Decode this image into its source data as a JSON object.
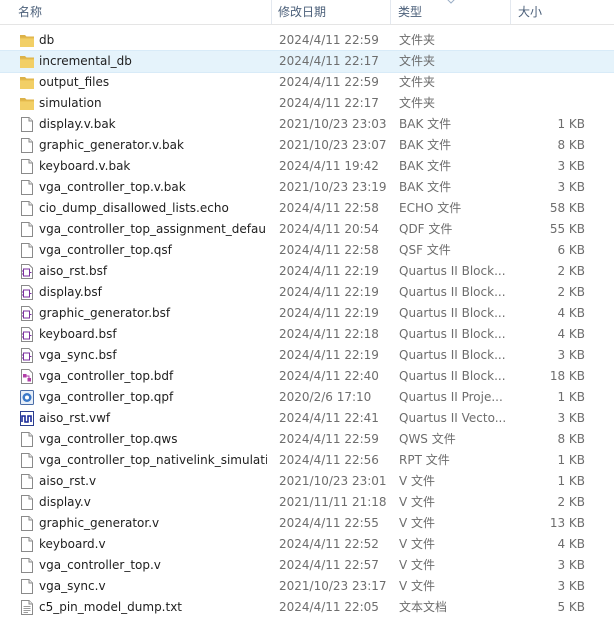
{
  "columns": {
    "name": "名称",
    "date": "修改日期",
    "type": "类型",
    "size": "大小"
  },
  "files": [
    {
      "name": "db",
      "date": "2024/4/11 22:59",
      "type": "文件夹",
      "size": "",
      "icon": "folder-icon"
    },
    {
      "name": "incremental_db",
      "date": "2024/4/11 22:17",
      "type": "文件夹",
      "size": "",
      "icon": "folder-icon",
      "selected": true
    },
    {
      "name": "output_files",
      "date": "2024/4/11 22:59",
      "type": "文件夹",
      "size": "",
      "icon": "folder-icon"
    },
    {
      "name": "simulation",
      "date": "2024/4/11 22:17",
      "type": "文件夹",
      "size": "",
      "icon": "folder-icon"
    },
    {
      "name": "display.v.bak",
      "date": "2021/10/23 23:03",
      "type": "BAK 文件",
      "size": "1 KB",
      "icon": "document-icon"
    },
    {
      "name": "graphic_generator.v.bak",
      "date": "2021/10/23 23:07",
      "type": "BAK 文件",
      "size": "8 KB",
      "icon": "document-icon"
    },
    {
      "name": "keyboard.v.bak",
      "date": "2024/4/11 19:42",
      "type": "BAK 文件",
      "size": "3 KB",
      "icon": "document-icon"
    },
    {
      "name": "vga_controller_top.v.bak",
      "date": "2021/10/23 23:19",
      "type": "BAK 文件",
      "size": "3 KB",
      "icon": "document-icon"
    },
    {
      "name": "cio_dump_disallowed_lists.echo",
      "date": "2024/4/11 22:58",
      "type": "ECHO 文件",
      "size": "58 KB",
      "icon": "document-icon"
    },
    {
      "name": "vga_controller_top_assignment_defau...",
      "date": "2024/4/11 20:54",
      "type": "QDF 文件",
      "size": "55 KB",
      "icon": "document-icon"
    },
    {
      "name": "vga_controller_top.qsf",
      "date": "2024/4/11 22:58",
      "type": "QSF 文件",
      "size": "6 KB",
      "icon": "document-icon"
    },
    {
      "name": "aiso_rst.bsf",
      "date": "2024/4/11 22:19",
      "type": "Quartus II Block...",
      "size": "2 KB",
      "icon": "bsf-file-icon"
    },
    {
      "name": "display.bsf",
      "date": "2024/4/11 22:19",
      "type": "Quartus II Block...",
      "size": "2 KB",
      "icon": "bsf-file-icon"
    },
    {
      "name": "graphic_generator.bsf",
      "date": "2024/4/11 22:19",
      "type": "Quartus II Block...",
      "size": "4 KB",
      "icon": "bsf-file-icon"
    },
    {
      "name": "keyboard.bsf",
      "date": "2024/4/11 22:18",
      "type": "Quartus II Block...",
      "size": "4 KB",
      "icon": "bsf-file-icon"
    },
    {
      "name": "vga_sync.bsf",
      "date": "2024/4/11 22:19",
      "type": "Quartus II Block...",
      "size": "3 KB",
      "icon": "bsf-file-icon"
    },
    {
      "name": "vga_controller_top.bdf",
      "date": "2024/4/11 22:40",
      "type": "Quartus II Block...",
      "size": "18 KB",
      "icon": "bdf-file-icon"
    },
    {
      "name": "vga_controller_top.qpf",
      "date": "2020/2/6 17:10",
      "type": "Quartus II Proje...",
      "size": "1 KB",
      "icon": "quartus-project-icon"
    },
    {
      "name": "aiso_rst.vwf",
      "date": "2024/4/11 22:41",
      "type": "Quartus II Vecto...",
      "size": "3 KB",
      "icon": "waveform-file-icon"
    },
    {
      "name": "vga_controller_top.qws",
      "date": "2024/4/11 22:59",
      "type": "QWS 文件",
      "size": "8 KB",
      "icon": "document-icon"
    },
    {
      "name": "vga_controller_top_nativelink_simulati...",
      "date": "2024/4/11 22:56",
      "type": "RPT 文件",
      "size": "1 KB",
      "icon": "document-icon"
    },
    {
      "name": "aiso_rst.v",
      "date": "2021/10/23 23:01",
      "type": "V 文件",
      "size": "1 KB",
      "icon": "document-icon"
    },
    {
      "name": "display.v",
      "date": "2021/11/11 21:18",
      "type": "V 文件",
      "size": "2 KB",
      "icon": "document-icon"
    },
    {
      "name": "graphic_generator.v",
      "date": "2024/4/11 22:55",
      "type": "V 文件",
      "size": "13 KB",
      "icon": "document-icon"
    },
    {
      "name": "keyboard.v",
      "date": "2024/4/11 22:52",
      "type": "V 文件",
      "size": "4 KB",
      "icon": "document-icon"
    },
    {
      "name": "vga_controller_top.v",
      "date": "2024/4/11 22:57",
      "type": "V 文件",
      "size": "3 KB",
      "icon": "document-icon"
    },
    {
      "name": "vga_sync.v",
      "date": "2021/10/23 23:17",
      "type": "V 文件",
      "size": "3 KB",
      "icon": "document-icon"
    },
    {
      "name": "c5_pin_model_dump.txt",
      "date": "2024/4/11 22:05",
      "type": "文本文档",
      "size": "5 KB",
      "icon": "text-file-icon"
    }
  ]
}
